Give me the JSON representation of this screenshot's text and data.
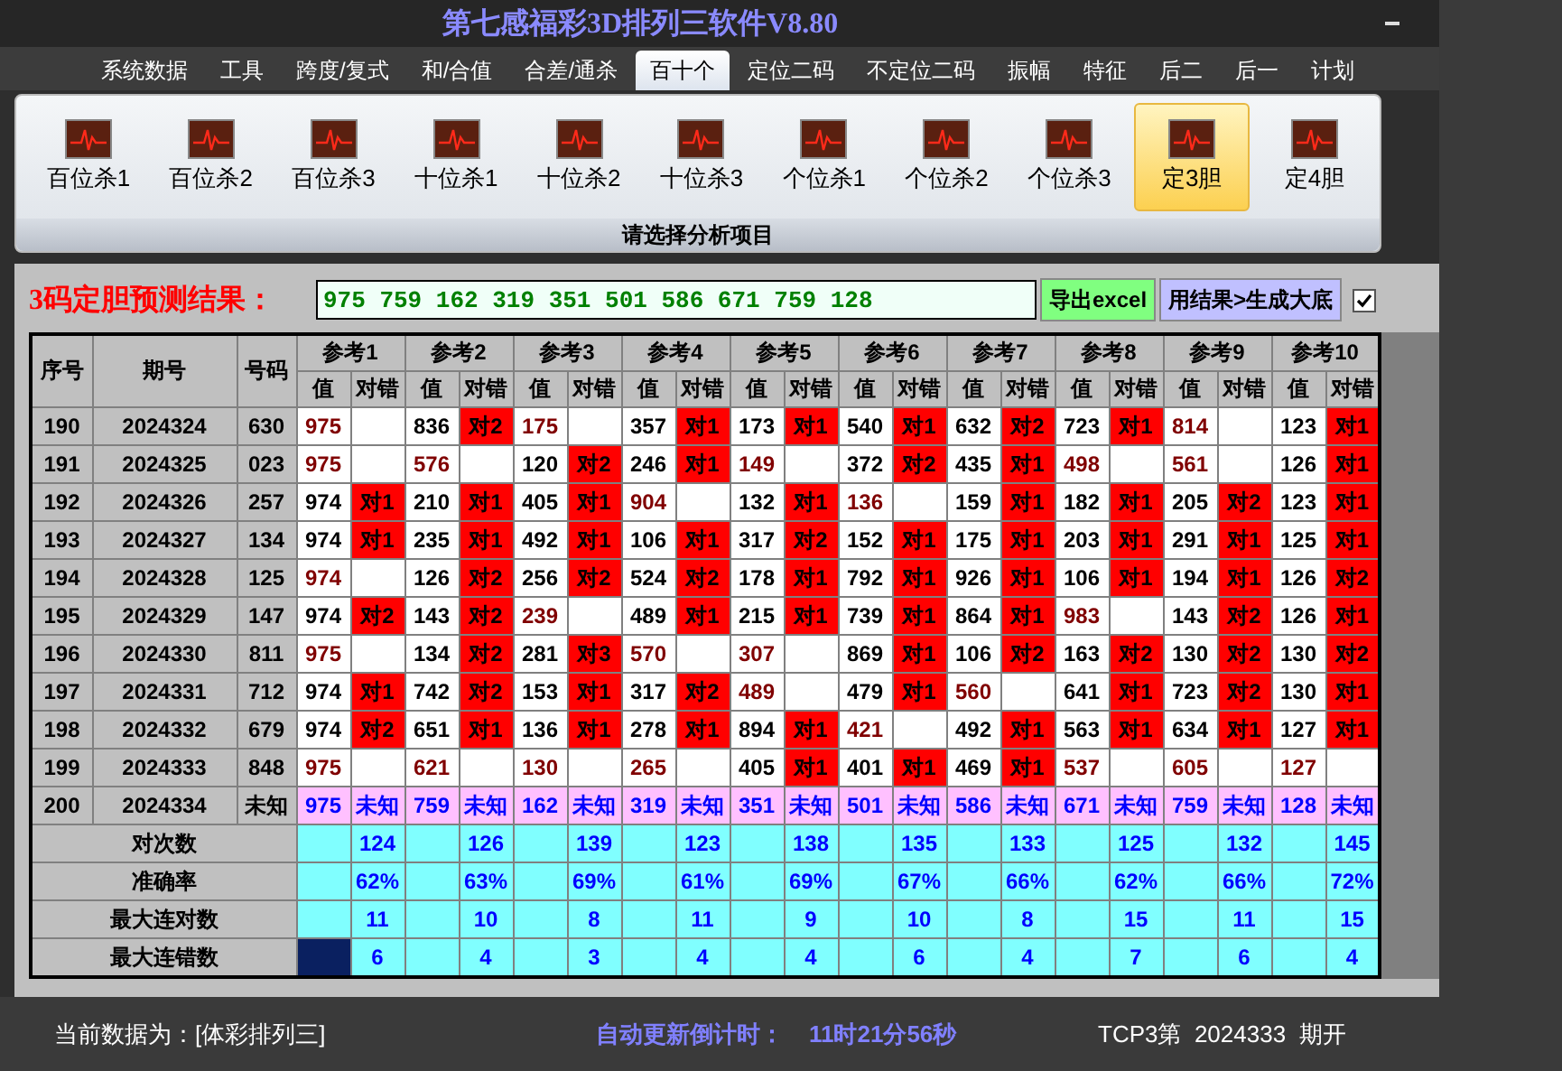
{
  "window": {
    "title": "第七感福彩3D排列三软件V8.80"
  },
  "menu": [
    {
      "label": "系统数据",
      "selected": false
    },
    {
      "label": "工具",
      "selected": false
    },
    {
      "label": "跨度/复式",
      "selected": false
    },
    {
      "label": "和/合值",
      "selected": false
    },
    {
      "label": "合差/通杀",
      "selected": false
    },
    {
      "label": "百十个",
      "selected": true
    },
    {
      "label": "定位二码",
      "selected": false
    },
    {
      "label": "不定位二码",
      "selected": false
    },
    {
      "label": "振幅",
      "selected": false
    },
    {
      "label": "特征",
      "selected": false
    },
    {
      "label": "后二",
      "selected": false
    },
    {
      "label": "后一",
      "selected": false
    },
    {
      "label": "计划",
      "selected": false
    }
  ],
  "ribbon": {
    "caption": "请选择分析项目",
    "items": [
      {
        "label": "百位杀1",
        "selected": false
      },
      {
        "label": "百位杀2",
        "selected": false
      },
      {
        "label": "百位杀3",
        "selected": false
      },
      {
        "label": "十位杀1",
        "selected": false
      },
      {
        "label": "十位杀2",
        "selected": false
      },
      {
        "label": "十位杀3",
        "selected": false
      },
      {
        "label": "个位杀1",
        "selected": false
      },
      {
        "label": "个位杀2",
        "selected": false
      },
      {
        "label": "个位杀3",
        "selected": false
      },
      {
        "label": "定3胆",
        "selected": true
      },
      {
        "label": "定4胆",
        "selected": false
      }
    ]
  },
  "result": {
    "label": "3码定胆预测结果：",
    "value": "975 759 162 319 351 501 586 671 759 128",
    "buttons": [
      {
        "label": "导出excel",
        "kind": "export"
      },
      {
        "label": "用结果>生成大底",
        "kind": "generate"
      }
    ],
    "checkbox": {
      "checked": true
    }
  },
  "table": {
    "columns": [
      "序号",
      "期号",
      "号码"
    ],
    "ref_columns": [
      {
        "label": "参考1",
        "value_header": "值",
        "result_header": "对错"
      },
      {
        "label": "参考2",
        "value_header": "值",
        "result_header": "对错"
      },
      {
        "label": "参考3",
        "value_header": "值",
        "result_header": "对错"
      },
      {
        "label": "参考4",
        "value_header": "值",
        "result_header": "对错"
      },
      {
        "label": "参考5",
        "value_header": "值",
        "result_header": "对错"
      },
      {
        "label": "参考6",
        "value_header": "值",
        "result_header": "对错"
      },
      {
        "label": "参考7",
        "value_header": "值",
        "result_header": "对错"
      },
      {
        "label": "参考8",
        "value_header": "值",
        "result_header": "对错"
      },
      {
        "label": "参考9",
        "value_header": "值",
        "result_header": "对错"
      },
      {
        "label": "参考10",
        "value_header": "值",
        "result_header": "对错"
      }
    ],
    "rows": [
      {
        "no": "190",
        "issue": "2024324",
        "code": "630",
        "pending": false,
        "refs": [
          {
            "value": "975",
            "hit": false
          },
          {
            "value": "836",
            "result": "对2",
            "hit": true
          },
          {
            "value": "175",
            "hit": false
          },
          {
            "value": "357",
            "result": "对1",
            "hit": true
          },
          {
            "value": "173",
            "result": "对1",
            "hit": true
          },
          {
            "value": "540",
            "result": "对1",
            "hit": true
          },
          {
            "value": "632",
            "result": "对2",
            "hit": true
          },
          {
            "value": "723",
            "result": "对1",
            "hit": true
          },
          {
            "value": "814",
            "hit": false
          },
          {
            "value": "123",
            "result": "对1",
            "hit": true
          }
        ]
      },
      {
        "no": "191",
        "issue": "2024325",
        "code": "023",
        "pending": false,
        "refs": [
          {
            "value": "975",
            "hit": false
          },
          {
            "value": "576",
            "hit": false
          },
          {
            "value": "120",
            "result": "对2",
            "hit": true
          },
          {
            "value": "246",
            "result": "对1",
            "hit": true
          },
          {
            "value": "149",
            "hit": false
          },
          {
            "value": "372",
            "result": "对2",
            "hit": true
          },
          {
            "value": "435",
            "result": "对1",
            "hit": true
          },
          {
            "value": "498",
            "hit": false
          },
          {
            "value": "561",
            "hit": false
          },
          {
            "value": "126",
            "result": "对1",
            "hit": true
          }
        ]
      },
      {
        "no": "192",
        "issue": "2024326",
        "code": "257",
        "pending": false,
        "refs": [
          {
            "value": "974",
            "result": "对1",
            "hit": true
          },
          {
            "value": "210",
            "result": "对1",
            "hit": true
          },
          {
            "value": "405",
            "result": "对1",
            "hit": true
          },
          {
            "value": "904",
            "hit": false
          },
          {
            "value": "132",
            "result": "对1",
            "hit": true
          },
          {
            "value": "136",
            "hit": false
          },
          {
            "value": "159",
            "result": "对1",
            "hit": true
          },
          {
            "value": "182",
            "result": "对1",
            "hit": true
          },
          {
            "value": "205",
            "result": "对2",
            "hit": true
          },
          {
            "value": "123",
            "result": "对1",
            "hit": true
          }
        ]
      },
      {
        "no": "193",
        "issue": "2024327",
        "code": "134",
        "pending": false,
        "refs": [
          {
            "value": "974",
            "result": "对1",
            "hit": true
          },
          {
            "value": "235",
            "result": "对1",
            "hit": true
          },
          {
            "value": "492",
            "result": "对1",
            "hit": true
          },
          {
            "value": "106",
            "result": "对1",
            "hit": true
          },
          {
            "value": "317",
            "result": "对2",
            "hit": true
          },
          {
            "value": "152",
            "result": "对1",
            "hit": true
          },
          {
            "value": "175",
            "result": "对1",
            "hit": true
          },
          {
            "value": "203",
            "result": "对1",
            "hit": true
          },
          {
            "value": "291",
            "result": "对1",
            "hit": true
          },
          {
            "value": "125",
            "result": "对1",
            "hit": true
          }
        ]
      },
      {
        "no": "194",
        "issue": "2024328",
        "code": "125",
        "pending": false,
        "refs": [
          {
            "value": "974",
            "hit": false
          },
          {
            "value": "126",
            "result": "对2",
            "hit": true
          },
          {
            "value": "256",
            "result": "对2",
            "hit": true
          },
          {
            "value": "524",
            "result": "对2",
            "hit": true
          },
          {
            "value": "178",
            "result": "对1",
            "hit": true
          },
          {
            "value": "792",
            "result": "对1",
            "hit": true
          },
          {
            "value": "926",
            "result": "对1",
            "hit": true
          },
          {
            "value": "106",
            "result": "对1",
            "hit": true
          },
          {
            "value": "194",
            "result": "对1",
            "hit": true
          },
          {
            "value": "126",
            "result": "对2",
            "hit": true
          }
        ]
      },
      {
        "no": "195",
        "issue": "2024329",
        "code": "147",
        "pending": false,
        "refs": [
          {
            "value": "974",
            "result": "对2",
            "hit": true
          },
          {
            "value": "143",
            "result": "对2",
            "hit": true
          },
          {
            "value": "239",
            "hit": false
          },
          {
            "value": "489",
            "result": "对1",
            "hit": true
          },
          {
            "value": "215",
            "result": "对1",
            "hit": true
          },
          {
            "value": "739",
            "result": "对1",
            "hit": true
          },
          {
            "value": "864",
            "result": "对1",
            "hit": true
          },
          {
            "value": "983",
            "hit": false
          },
          {
            "value": "143",
            "result": "对2",
            "hit": true
          },
          {
            "value": "126",
            "result": "对1",
            "hit": true
          }
        ]
      },
      {
        "no": "196",
        "issue": "2024330",
        "code": "811",
        "pending": false,
        "refs": [
          {
            "value": "975",
            "hit": false
          },
          {
            "value": "134",
            "result": "对2",
            "hit": true
          },
          {
            "value": "281",
            "result": "对3",
            "hit": true
          },
          {
            "value": "570",
            "hit": false
          },
          {
            "value": "307",
            "hit": false
          },
          {
            "value": "869",
            "result": "对1",
            "hit": true
          },
          {
            "value": "106",
            "result": "对2",
            "hit": true
          },
          {
            "value": "163",
            "result": "对2",
            "hit": true
          },
          {
            "value": "130",
            "result": "对2",
            "hit": true
          },
          {
            "value": "130",
            "result": "对2",
            "hit": true
          }
        ]
      },
      {
        "no": "197",
        "issue": "2024331",
        "code": "712",
        "pending": false,
        "refs": [
          {
            "value": "974",
            "result": "对1",
            "hit": true
          },
          {
            "value": "742",
            "result": "对2",
            "hit": true
          },
          {
            "value": "153",
            "result": "对1",
            "hit": true
          },
          {
            "value": "317",
            "result": "对2",
            "hit": true
          },
          {
            "value": "489",
            "hit": false
          },
          {
            "value": "479",
            "result": "对1",
            "hit": true
          },
          {
            "value": "560",
            "hit": false
          },
          {
            "value": "641",
            "result": "对1",
            "hit": true
          },
          {
            "value": "723",
            "result": "对2",
            "hit": true
          },
          {
            "value": "130",
            "result": "对1",
            "hit": true
          }
        ]
      },
      {
        "no": "198",
        "issue": "2024332",
        "code": "679",
        "pending": false,
        "refs": [
          {
            "value": "974",
            "result": "对2",
            "hit": true
          },
          {
            "value": "651",
            "result": "对1",
            "hit": true
          },
          {
            "value": "136",
            "result": "对1",
            "hit": true
          },
          {
            "value": "278",
            "result": "对1",
            "hit": true
          },
          {
            "value": "894",
            "result": "对1",
            "hit": true
          },
          {
            "value": "421",
            "hit": false
          },
          {
            "value": "492",
            "result": "对1",
            "hit": true
          },
          {
            "value": "563",
            "result": "对1",
            "hit": true
          },
          {
            "value": "634",
            "result": "对1",
            "hit": true
          },
          {
            "value": "127",
            "result": "对1",
            "hit": true
          }
        ]
      },
      {
        "no": "199",
        "issue": "2024333",
        "code": "848",
        "pending": false,
        "refs": [
          {
            "value": "975",
            "hit": false
          },
          {
            "value": "621",
            "hit": false
          },
          {
            "value": "130",
            "hit": false
          },
          {
            "value": "265",
            "hit": false
          },
          {
            "value": "405",
            "result": "对1",
            "hit": true
          },
          {
            "value": "401",
            "result": "对1",
            "hit": true
          },
          {
            "value": "469",
            "result": "对1",
            "hit": true
          },
          {
            "value": "537",
            "hit": false
          },
          {
            "value": "605",
            "hit": false
          },
          {
            "value": "127",
            "hit": false
          }
        ]
      },
      {
        "no": "200",
        "issue": "2024334",
        "code": "未知",
        "pending": true,
        "refs": [
          {
            "value": "975",
            "result": "未知",
            "hit": false
          },
          {
            "value": "759",
            "result": "未知",
            "hit": false
          },
          {
            "value": "162",
            "result": "未知",
            "hit": false
          },
          {
            "value": "319",
            "result": "未知",
            "hit": false
          },
          {
            "value": "351",
            "result": "未知",
            "hit": false
          },
          {
            "value": "501",
            "result": "未知",
            "hit": false
          },
          {
            "value": "586",
            "result": "未知",
            "hit": false
          },
          {
            "value": "671",
            "result": "未知",
            "hit": false
          },
          {
            "value": "759",
            "result": "未知",
            "hit": false
          },
          {
            "value": "128",
            "result": "未知",
            "hit": false
          }
        ]
      }
    ],
    "stats": [
      {
        "label": "对次数",
        "focused": false,
        "values": [
          "124",
          "126",
          "139",
          "123",
          "138",
          "135",
          "133",
          "125",
          "132",
          "145"
        ]
      },
      {
        "label": "准确率",
        "focused": false,
        "values": [
          "62%",
          "63%",
          "69%",
          "61%",
          "69%",
          "67%",
          "66%",
          "62%",
          "66%",
          "72%"
        ]
      },
      {
        "label": "最大连对数",
        "focused": false,
        "values": [
          "11",
          "10",
          "8",
          "11",
          "9",
          "10",
          "8",
          "15",
          "11",
          "15"
        ]
      },
      {
        "label": "最大连错数",
        "focused": true,
        "values": [
          "6",
          "4",
          "3",
          "4",
          "4",
          "6",
          "4",
          "7",
          "6",
          "4"
        ]
      }
    ]
  },
  "status_bar": {
    "source": "当前数据为：[体彩排列三]",
    "countdown_label": "自动更新倒计时：",
    "countdown": "11时21分56秒",
    "draw": "TCP3第  2024333  期开"
  }
}
